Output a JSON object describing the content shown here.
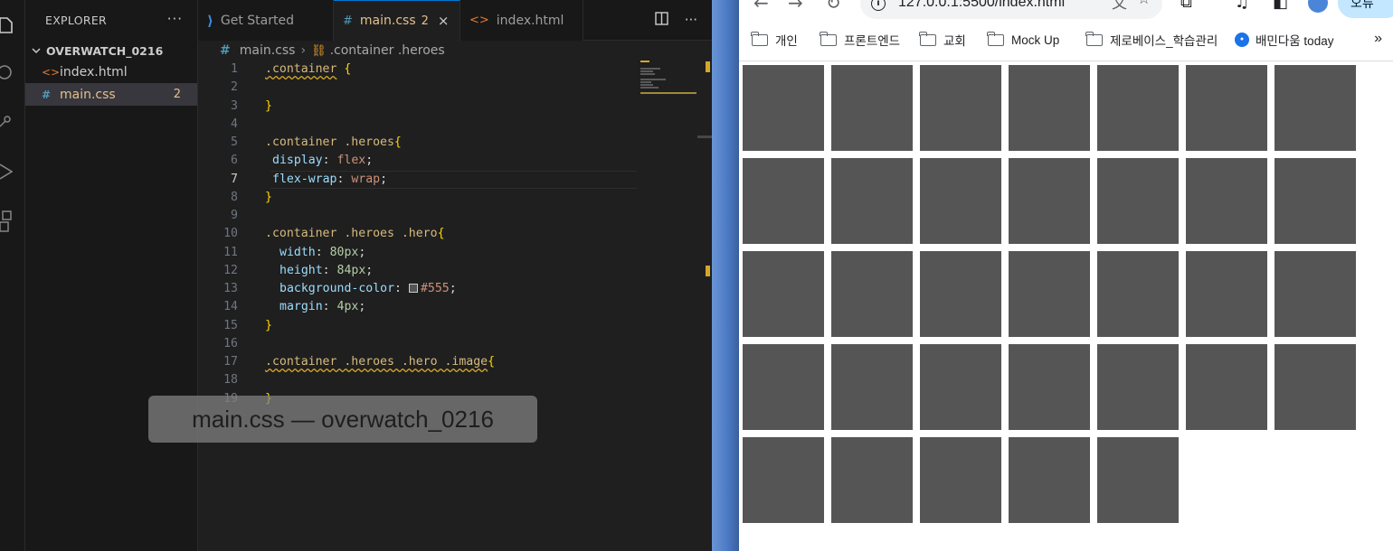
{
  "vscode": {
    "sidebar": {
      "title": "EXPLORER",
      "more": "···",
      "folder": "OVERWATCH_0216",
      "files": [
        {
          "name": "index.html",
          "type": "html",
          "badge": ""
        },
        {
          "name": "main.css",
          "type": "css",
          "badge": "2",
          "selected": true
        }
      ]
    },
    "tabs": [
      {
        "label": "Get Started",
        "icon": "vscode-icon",
        "dirty": ""
      },
      {
        "label": "main.css",
        "icon": "css-hash-icon",
        "dirty": "2",
        "close": "×"
      },
      {
        "label": "index.html",
        "icon": "html-icon",
        "dirty": ""
      }
    ],
    "tab_actions": [
      "split-editor-icon",
      "more-actions-icon"
    ],
    "breadcrumb": {
      "file": "main.css",
      "symbol": ".container .heroes"
    },
    "line_numbers": [
      "1",
      "2",
      "3",
      "4",
      "5",
      "6",
      "7",
      "8",
      "9",
      "10",
      "11",
      "12",
      "13",
      "14",
      "15",
      "16",
      "17",
      "18",
      "19"
    ],
    "current_line": 7,
    "code": {
      "l1_sel": ".container",
      "l1_brace": "{",
      "l3_brace": "}",
      "l5_sel": ".container .heroes",
      "l5_brace": "{",
      "l6_prop": "display",
      "l6_val": "flex",
      "l7_prop": "flex-wrap",
      "l7_val": "wrap",
      "l8_brace": "}",
      "l10_sel": ".container .heroes .hero",
      "l10_brace": "{",
      "l11_prop": "width",
      "l11_val": "80px",
      "l12_prop": "height",
      "l12_val": "84px",
      "l13_prop": "background-color",
      "l13_val": "#555",
      "l14_prop": "margin",
      "l14_val": "4px",
      "l15_brace": "}",
      "l17_sel": ".container .heroes .hero .image",
      "l17_brace": "{",
      "l19_brace": "}"
    },
    "window_title_overlay": "main.css — overwatch_0216"
  },
  "browser": {
    "url": "127.0.0.1:5500/index.html",
    "profile_label": "오류",
    "bookmarks": [
      {
        "label": "개인",
        "type": "folder"
      },
      {
        "label": "프론트엔드",
        "type": "folder"
      },
      {
        "label": "교회",
        "type": "folder"
      },
      {
        "label": "Mock Up",
        "type": "folder"
      },
      {
        "label": "제로베이스_학습관리",
        "type": "folder"
      },
      {
        "label": "배민다움 today",
        "type": "site"
      }
    ],
    "bookmarks_more": "»",
    "hero_count": 33,
    "hero_color": "#555555"
  }
}
